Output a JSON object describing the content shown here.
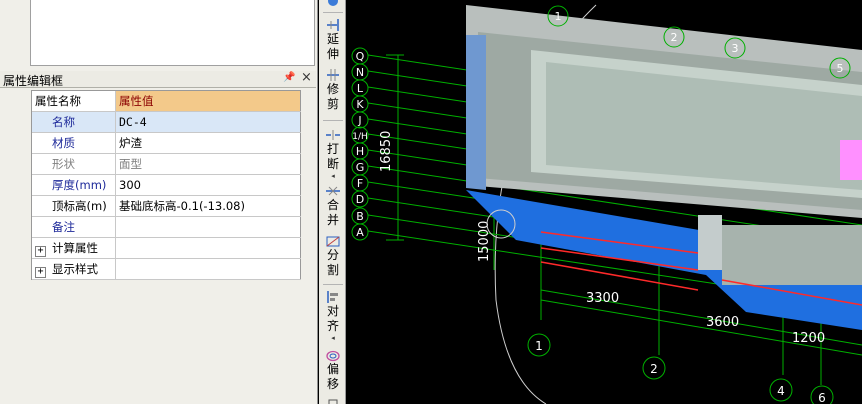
{
  "panel": {
    "title": "属性编辑框",
    "pin_icon": "pin-icon",
    "close_label": "×"
  },
  "prop_table": {
    "col_name": "属性名称",
    "col_value": "属性值",
    "rows": [
      {
        "name": "名称",
        "value": "DC-4"
      },
      {
        "name": "材质",
        "value": "炉渣"
      },
      {
        "name": "形状",
        "value": "面型"
      },
      {
        "name": "厚度(mm)",
        "value": "300"
      },
      {
        "name": "顶标高(m)",
        "value": "基础底标高-0.1(-13.08)"
      },
      {
        "name": "备注",
        "value": ""
      }
    ],
    "groups": [
      {
        "label": "计算属性",
        "expander": "+"
      },
      {
        "label": "显示样式",
        "expander": "+"
      }
    ]
  },
  "toolbar": {
    "items": [
      {
        "label": "延伸",
        "icon": "extend-icon"
      },
      {
        "label": "修剪",
        "icon": "trim-icon"
      },
      {
        "label": "打断",
        "icon": "break-icon"
      },
      {
        "label": "合并",
        "icon": "merge-icon"
      },
      {
        "label": "分割",
        "icon": "split-icon"
      },
      {
        "label": "对齐",
        "icon": "align-icon"
      },
      {
        "label": "偏移",
        "icon": "offset-icon"
      }
    ]
  },
  "cad": {
    "row_axes": [
      "Q",
      "N",
      "L",
      "K",
      "J",
      "1/H",
      "H",
      "G",
      "F",
      "D",
      "B",
      "A"
    ],
    "col_axes": [
      "1",
      "2",
      "3",
      "4",
      "5",
      "6"
    ],
    "top_axes": [
      "1",
      "2",
      "3",
      "5"
    ],
    "dim_vertical": "16850",
    "dim_radius": "15000",
    "dim_1": "3300",
    "dim_2": "3600",
    "dim_3": "1200",
    "colors": {
      "grid": "#00c000",
      "slab": "#1f6fe0",
      "wall": "#c9cfcf",
      "red_line": "#ff2a2a",
      "pink": "#ff80ff"
    }
  }
}
